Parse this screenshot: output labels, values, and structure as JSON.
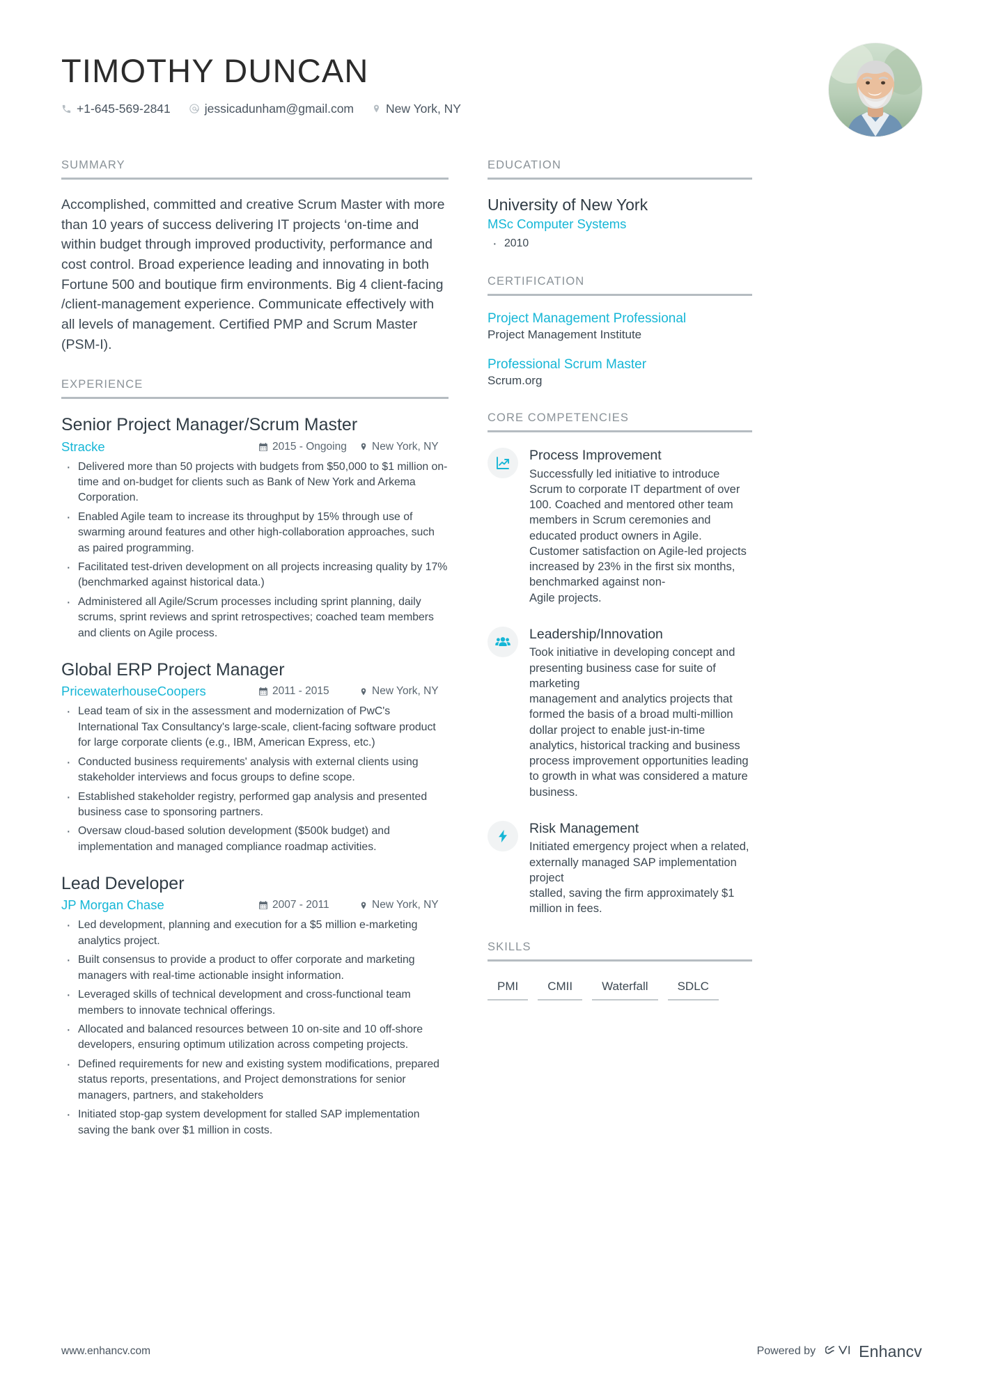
{
  "header": {
    "name": "TIMOTHY DUNCAN",
    "contacts": [
      {
        "icon": "phone-icon",
        "text": "+1-645-569-2841"
      },
      {
        "icon": "email-icon",
        "text": "jessicadunham@gmail.com"
      },
      {
        "icon": "location-pin-icon",
        "text": "New York, NY"
      }
    ],
    "avatar_alt": "profile-photo"
  },
  "left": {
    "summary": {
      "title": "SUMMARY",
      "text": "Accomplished, committed and creative Scrum Master with more than 10 years of success delivering IT projects ‘on-time and within budget through improved productivity, performance and cost control. Broad experience leading and innovating in both Fortune 500 and boutique firm environments. Big 4 client-facing /client-management experience. Communicate effectively with all levels of management. Certified PMP and Scrum Master (PSM-I)."
    },
    "experience": {
      "title": "EXPERIENCE",
      "jobs": [
        {
          "title": "Senior Project Manager/Scrum Master",
          "company": "Stracke",
          "date": "2015 - Ongoing",
          "location": "New York, NY",
          "bullets": [
            "Delivered more than 50 projects with budgets from $50,000 to $1 million on-time and on-budget for clients such as Bank of New York and Arkema Corporation.",
            "Enabled Agile team to increase its throughput by 15% through use of swarming around features and other high-collaboration approaches, such as paired programming.",
            "Facilitated test-driven development on all projects increasing quality by 17% (benchmarked against historical data.)",
            "Administered all Agile/Scrum processes including sprint planning, daily scrums, sprint reviews and sprint retrospectives; coached team members and clients on Agile process."
          ]
        },
        {
          "title": "Global ERP Project Manager",
          "company": "PricewaterhouseCoopers",
          "date": "2011 - 2015",
          "location": "New York, NY",
          "bullets": [
            "Lead team of six in the assessment and modernization of PwC's International Tax Consultancy's large-scale, client-facing software product for large corporate clients (e.g., IBM, American Express, etc.)",
            "Conducted business requirements' analysis with external clients using stakeholder interviews and focus groups to define scope.",
            "Established stakeholder registry, performed gap analysis and presented business case to sponsoring partners.",
            "Oversaw cloud-based solution development ($500k budget) and implementation and managed compliance roadmap activities."
          ]
        },
        {
          "title": "Lead Developer",
          "company": "JP Morgan Chase",
          "date": "2007 - 2011",
          "location": "New York, NY",
          "bullets": [
            "Led development, planning and execution for a $5 million e-marketing analytics project.",
            "Built consensus to provide a product to offer corporate and marketing managers with real-time actionable insight information.",
            "Leveraged skills of technical development and cross-functional team members to innovate technical offerings.",
            "Allocated and balanced resources between 10 on-site and 10 off-shore developers, ensuring optimum utilization across competing projects.",
            "Defined requirements for new and existing system modifications, prepared status reports, presentations, and Project demonstrations for senior managers, partners, and stakeholders",
            "Initiated stop-gap system development for stalled SAP implementation saving the bank over $1 million in costs."
          ]
        }
      ]
    }
  },
  "right": {
    "education": {
      "title": "EDUCATION",
      "school": "University of New York",
      "degree": "MSc Computer Systems",
      "year": "2010"
    },
    "certification": {
      "title": "CERTIFICATION",
      "items": [
        {
          "name": "Project Management Professional",
          "org": "Project Management Institute"
        },
        {
          "name": "Professional Scrum Master",
          "org": "Scrum.org"
        }
      ]
    },
    "competencies": {
      "title": "CORE COMPETENCIES",
      "items": [
        {
          "icon": "line-chart-icon",
          "name": "Process Improvement",
          "desc": "Successfully led initiative to introduce Scrum to corporate IT department of over 100. Coached and mentored other team members in Scrum ceremonies and educated product owners in Agile. Customer satisfaction on Agile-led projects increased by 23% in the first six months, benchmarked against non-\nAgile projects."
        },
        {
          "icon": "people-group-icon",
          "name": "Leadership/Innovation",
          "desc": "Took initiative in developing concept and presenting business case for suite of marketing\nmanagement and analytics projects that formed the basis of a broad multi-million dollar project to enable just-in-time analytics, historical tracking and business process improvement opportunities leading to growth in what was considered a mature business."
        },
        {
          "icon": "lightning-bolt-icon",
          "name": "Risk Management",
          "desc": "Initiated emergency project when a related, externally managed SAP implementation project\nstalled, saving the firm approximately $1 million in fees."
        }
      ]
    },
    "skills": {
      "title": "SKILLS",
      "tags": [
        "PMI",
        "CMII",
        "Waterfall",
        "SDLC"
      ]
    }
  },
  "footer": {
    "website": "www.enhancv.com",
    "powered_by": "Powered by",
    "brand": "Enhancv"
  },
  "colors": {
    "accent": "#15b6d6",
    "text": "#3c4852",
    "muted": "#8a9298",
    "rule": "#b5bcc1"
  }
}
